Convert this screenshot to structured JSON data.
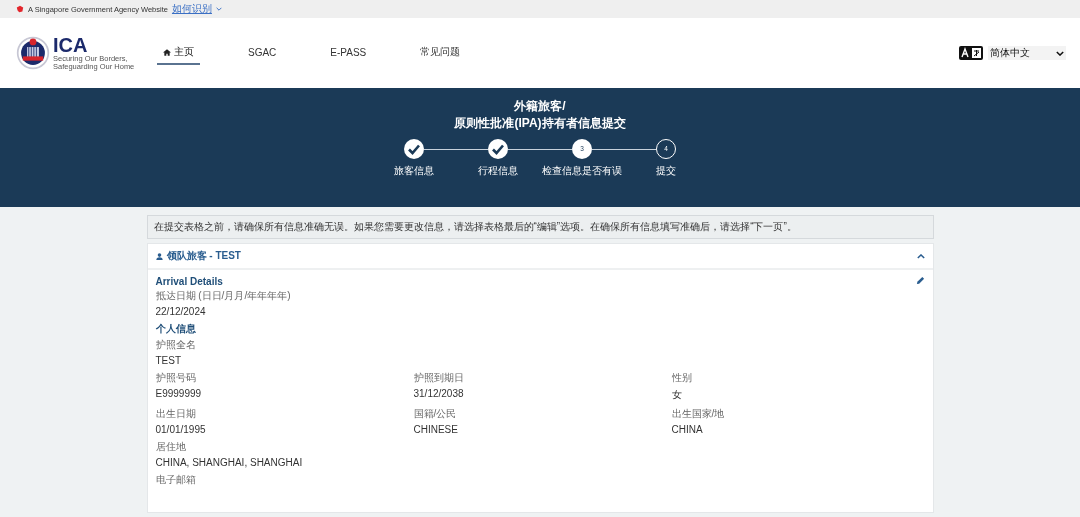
{
  "gov_bar": {
    "text": "A Singapore Government Agency Website",
    "link": "如何识别"
  },
  "nav": {
    "logo": "ICA",
    "logo_tagline": "Securing Our Borders, Safeguarding Our Home",
    "items": [
      {
        "label": "主页",
        "selected": true,
        "kind": "home"
      },
      {
        "label": "SGAC",
        "selected": false,
        "kind": "text"
      },
      {
        "label": "E-PASS",
        "selected": false,
        "kind": "text"
      },
      {
        "label": "常见问题",
        "selected": false,
        "kind": "text"
      }
    ],
    "language": "简体中文"
  },
  "banner": {
    "title_lines": [
      "外籍旅客/",
      "原则性批准(IPA)持有者信息提交"
    ],
    "steps": [
      {
        "label": "旅客信息",
        "kind": "done"
      },
      {
        "label": "行程信息",
        "kind": "done"
      },
      {
        "number": "3",
        "label": "检查信息是否有误",
        "kind": "current"
      },
      {
        "number": "4",
        "label": "提交",
        "kind": "pending"
      }
    ]
  },
  "notice": "在提交表格之前，请确保所有信息准确无误。如果您需要更改信息，请选择表格最后的“编辑”选项。在确保所有信息填写准确后，请选择“下一页”。",
  "panel": {
    "title": "领队旅客 - TEST",
    "expanded": true,
    "sections": [
      {
        "heading": "Arrival Details",
        "rows": [
          [
            {
              "label": "抵达日期 (日日/月月/年年年年)",
              "value": "22/12/2024"
            }
          ]
        ]
      },
      {
        "heading": "个人信息",
        "rows": [
          [
            {
              "label": "护照全名",
              "value": "TEST"
            }
          ],
          [
            {
              "label": "护照号码",
              "value": "E9999999"
            },
            {
              "label": "护照到期日",
              "value": "31/12/2038"
            },
            {
              "label": "性别",
              "value": "女"
            }
          ],
          [
            {
              "label": "出生日期",
              "value": "01/01/1995"
            },
            {
              "label": "国籍/公民",
              "value": "CHINESE"
            },
            {
              "label": "出生国家/地",
              "value": "CHINA"
            }
          ],
          [
            {
              "label": "居住地",
              "value": "CHINA, SHANGHAI, SHANGHAI"
            }
          ],
          [
            {
              "label": "电子邮箱"
            }
          ]
        ]
      }
    ]
  }
}
